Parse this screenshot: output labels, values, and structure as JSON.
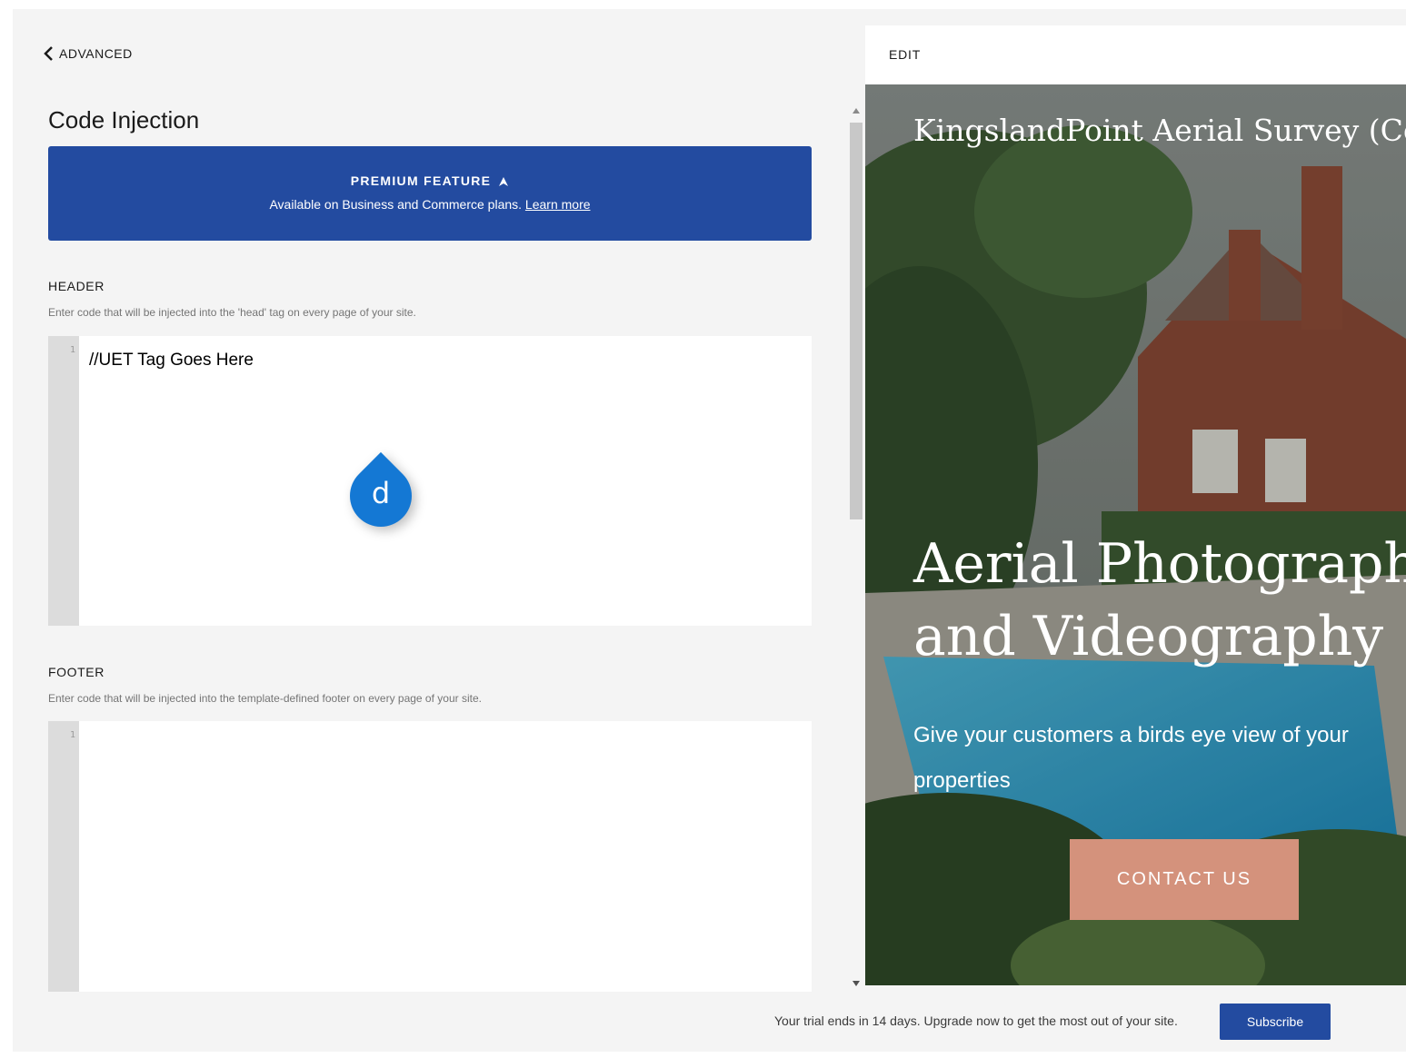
{
  "nav": {
    "back_label": "ADVANCED"
  },
  "page": {
    "title": "Code Injection"
  },
  "premium": {
    "title": "PREMIUM FEATURE",
    "description": "Available on Business and Commerce plans.",
    "link": "Learn more"
  },
  "header_section": {
    "label": "HEADER",
    "help": "Enter code that will be injected into the 'head' tag on every page of your site.",
    "line_number": "1",
    "code": "//UET Tag Goes Here"
  },
  "footer_section": {
    "label": "FOOTER",
    "help": "Enter code that will be injected into the template-defined footer on every page of your site.",
    "line_number": "1",
    "code": ""
  },
  "cursor_badge": {
    "letter": "d"
  },
  "preview": {
    "edit_label": "EDIT",
    "site_title": "KingslandPoint Aerial Survey (Copy)",
    "heading_line1": "Aerial Photography",
    "heading_line2": "and Videography",
    "subheading": "Give your customers a birds eye view of your properties",
    "cta": "CONTACT US"
  },
  "footer_bar": {
    "trial_text": "Your trial ends in 14 days. Upgrade now to get the most out of your site.",
    "subscribe_label": "Subscribe"
  },
  "colors": {
    "accent_blue": "#234ba0",
    "cta": "#d4927c",
    "panel_bg": "#f4f4f4",
    "cursor_badge": "#1478d4"
  }
}
